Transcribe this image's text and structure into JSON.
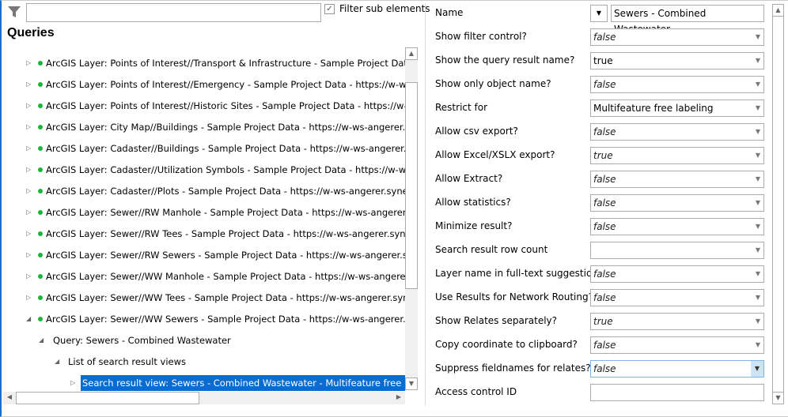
{
  "filter": {
    "icon": "filter-icon",
    "value": "",
    "checkbox_label": "Filter sub elements",
    "checked": true
  },
  "tree": {
    "title": "Queries",
    "items": [
      {
        "level": 1,
        "expanded": false,
        "status": "green",
        "text": "ArcGIS Layer: Points of Interest//Transport & Infrastructure - Sample Project Data - https:/"
      },
      {
        "level": 1,
        "expanded": false,
        "status": "green",
        "text": "ArcGIS Layer: Points of Interest//Emergency - Sample Project Data - https://w-ws-angerer.synergis.i"
      },
      {
        "level": 1,
        "expanded": false,
        "status": "green",
        "text": "ArcGIS Layer: Points of Interest//Historic Sites - Sample Project Data - https://w-ws-angere"
      },
      {
        "level": 1,
        "expanded": false,
        "status": "green",
        "text": "ArcGIS Layer: City Map//Buildings - Sample Project Data - https://w-ws-angerer.synergis.i"
      },
      {
        "level": 1,
        "expanded": false,
        "status": "green",
        "text": "ArcGIS Layer: Cadaster//Buildings - Sample Project Data - https://w-ws-angerer.synergis.i"
      },
      {
        "level": 1,
        "expanded": false,
        "status": "green",
        "text": "ArcGIS Layer: Cadaster//Utilization Symbols - Sample Project Data - https://w-ws-angerer."
      },
      {
        "level": 1,
        "expanded": false,
        "status": "green",
        "text": "ArcGIS Layer: Cadaster//Plots - Sample Project Data - https://w-ws-angerer.synergis.intern"
      },
      {
        "level": 1,
        "expanded": false,
        "status": "green",
        "text": "ArcGIS Layer: Sewer//RW Manhole - Sample Project Data - https://w-ws-angerer.synergis."
      },
      {
        "level": 1,
        "expanded": false,
        "status": "green",
        "text": "ArcGIS Layer: Sewer//RW Tees - Sample Project Data - https://w-ws-angerer.synergis.inter"
      },
      {
        "level": 1,
        "expanded": false,
        "status": "green",
        "text": "ArcGIS Layer: Sewer//RW Sewers - Sample Project Data - https://w-ws-angerer.synergis.in"
      },
      {
        "level": 1,
        "expanded": false,
        "status": "green",
        "text": "ArcGIS Layer: Sewer//WW Manhole - Sample Project Data - https://w-ws-angerer.synergis"
      },
      {
        "level": 1,
        "expanded": false,
        "status": "green",
        "text": "ArcGIS Layer: Sewer//WW Tees - Sample Project Data - https://w-ws-angerer.synergis.inte"
      },
      {
        "level": 1,
        "expanded": true,
        "status": "green",
        "text": "ArcGIS Layer: Sewer//WW Sewers - Sample Project Data - https://w-ws-angerer.synergis.ir"
      },
      {
        "level": 2,
        "expanded": true,
        "text": "Query: Sewers - Combined Wastewater"
      },
      {
        "level": 3,
        "expanded": true,
        "text": "List of search result views"
      },
      {
        "level": 4,
        "expanded": false,
        "selected": true,
        "text": "Search result view: Sewers - Combined Wastewater - Multifeature free labeling"
      }
    ]
  },
  "properties": [
    {
      "label": "Name",
      "value": "Sewers - Combined Wastewater",
      "default": false,
      "kind": "name"
    },
    {
      "label": "Show filter control?",
      "value": "false",
      "default": true
    },
    {
      "label": "Show the query result name?",
      "value": "true",
      "default": false
    },
    {
      "label": "Show only object name?",
      "value": "false",
      "default": true
    },
    {
      "label": "Restrict for",
      "value": "Multifeature free labeling",
      "default": false
    },
    {
      "label": "Allow csv export?",
      "value": "false",
      "default": true
    },
    {
      "label": "Allow Excel/XSLX export?",
      "value": "true",
      "default": true
    },
    {
      "label": "Allow Extract?",
      "value": "false",
      "default": true
    },
    {
      "label": "Allow statistics?",
      "value": "false",
      "default": true
    },
    {
      "label": "Minimize result?",
      "value": "false",
      "default": true
    },
    {
      "label": "Search result row count",
      "value": "",
      "default": false
    },
    {
      "label": "Layer name in full-text suggestion?",
      "value": "false",
      "default": true
    },
    {
      "label": "Use Results for Network Routing?",
      "value": "false",
      "default": true
    },
    {
      "label": "Show Relates separately?",
      "value": "true",
      "default": true
    },
    {
      "label": "Copy coordinate to clipboard?",
      "value": "false",
      "default": true
    },
    {
      "label": "Suppress fieldnames for relates?",
      "value": "false",
      "default": true,
      "focused": true
    },
    {
      "label": "Access control ID",
      "value": "",
      "default": false,
      "kind": "text"
    }
  ],
  "colors": {
    "selection": "#0a6ccf",
    "status_green": "#1db43c",
    "accent_border": "#1a6fc4"
  }
}
